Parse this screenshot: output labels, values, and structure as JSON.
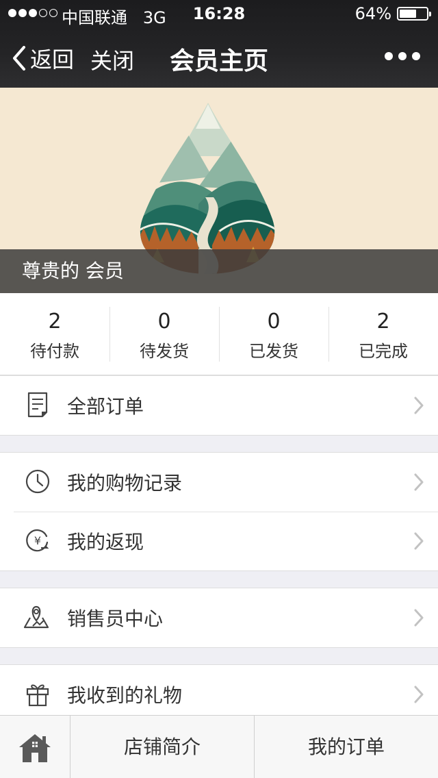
{
  "status_bar": {
    "carrier": "中国联通",
    "network": "3G",
    "time": "16:28",
    "battery_percent_text": "64%",
    "battery_level": 0.64,
    "signal_bars_filled": 3,
    "signal_bars_total": 5
  },
  "nav": {
    "back_label": "返回",
    "close_label": "关闭",
    "title": "会员主页"
  },
  "banner": {
    "member_label": "尊贵的 会员"
  },
  "order_stats": [
    {
      "count": "2",
      "label": "待付款"
    },
    {
      "count": "0",
      "label": "待发货"
    },
    {
      "count": "0",
      "label": "已发货"
    },
    {
      "count": "2",
      "label": "已完成"
    }
  ],
  "menu": {
    "all_orders": {
      "label": "全部订单",
      "icon": "document-icon"
    },
    "purchase_history": {
      "label": "我的购物记录",
      "icon": "clock-icon"
    },
    "cashback": {
      "label": "我的返现",
      "icon": "yuan-return-icon"
    },
    "sales_center": {
      "label": "销售员中心",
      "icon": "location-pin-icon"
    },
    "gifts": {
      "label": "我收到的礼物",
      "icon": "gift-icon"
    }
  },
  "tabbar": {
    "home_icon": "home-icon",
    "shop_intro": "店铺简介",
    "my_orders": "我的订单"
  },
  "colors": {
    "banner_bg": "#f5e8d2",
    "nav_bg": "#1c1c1e",
    "mountain_teal": "#1f6b5c",
    "mountain_orange": "#b5622a"
  }
}
